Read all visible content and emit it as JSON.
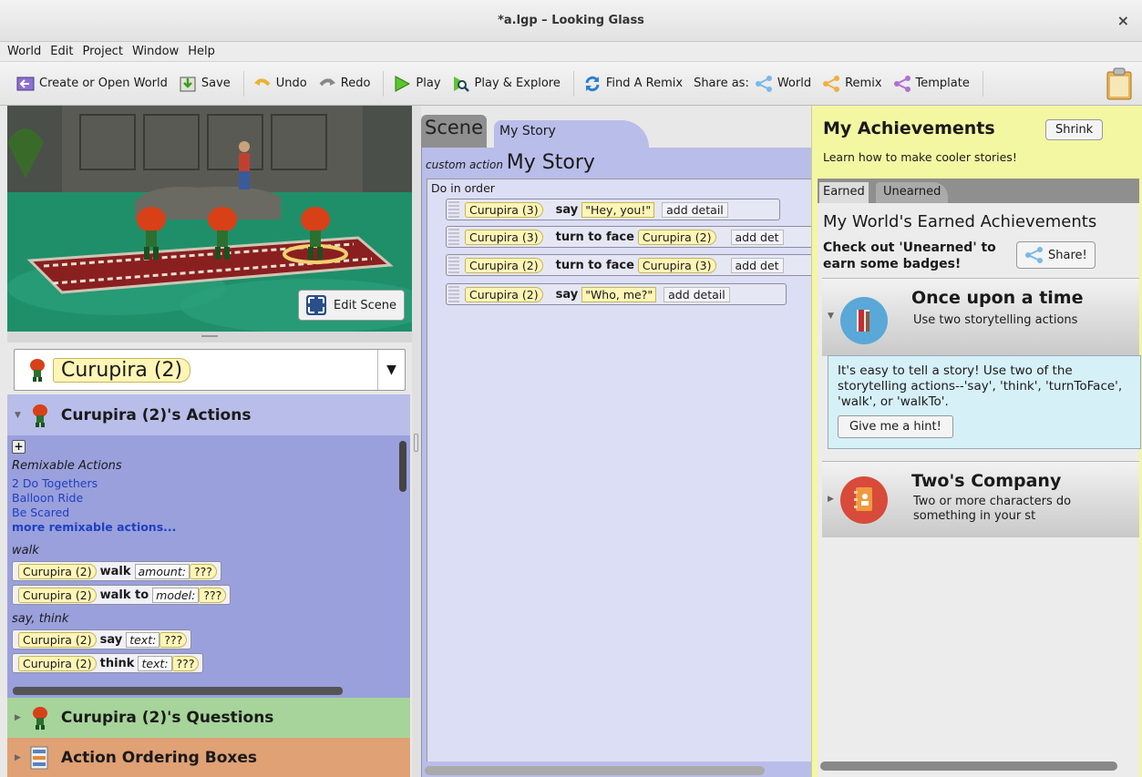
{
  "window": {
    "title": "*a.lgp – Looking Glass",
    "close": "×"
  },
  "menu": [
    "World",
    "Edit",
    "Project",
    "Window",
    "Help"
  ],
  "toolbar": {
    "create": "Create or Open World",
    "save": "Save",
    "undo": "Undo",
    "redo": "Redo",
    "play": "Play",
    "explore": "Play & Explore",
    "remix": "Find A Remix",
    "share_as": "Share as:",
    "share_world": "World",
    "share_remix": "Remix",
    "share_template": "Template"
  },
  "scene": {
    "edit_scene": "Edit Scene"
  },
  "selector": {
    "selected": "Curupira (2)"
  },
  "actions": {
    "header": "Curupira (2)'s Actions",
    "plus": "+",
    "remix_title": "Remixable Actions",
    "remix_items": [
      "2 Do Togethers",
      "Balloon Ride",
      "Be Scared"
    ],
    "more": "more remixable actions...",
    "walk_section": "walk",
    "walk": {
      "subject": "Curupira (2)",
      "verb": "walk",
      "param": "amount:",
      "val": "???"
    },
    "walkto": {
      "subject": "Curupira (2)",
      "verb": "walk to",
      "param": "model:",
      "val": "???"
    },
    "say_section": "say, think",
    "say": {
      "subject": "Curupira (2)",
      "verb": "say",
      "param": "text:",
      "val": "???"
    },
    "think": {
      "subject": "Curupira (2)",
      "verb": "think",
      "param": "text:",
      "val": "???"
    }
  },
  "questions": {
    "header": "Curupira (2)'s Questions"
  },
  "ordering": {
    "header": "Action Ordering Boxes"
  },
  "editor": {
    "tab_scene": "Scene",
    "tab_story": "My Story",
    "custom_action": "custom action",
    "story_name": "My Story",
    "do_in_order": "Do in order",
    "stmts": [
      {
        "subject": "Curupira (3)",
        "verb": "say",
        "arg": "\"Hey, you!\"",
        "detail": "add detail"
      },
      {
        "subject": "Curupira (3)",
        "verb": "turn to face",
        "arg": "Curupira (2)",
        "detail": "add det"
      },
      {
        "subject": "Curupira (2)",
        "verb": "turn to face",
        "arg": "Curupira (3)",
        "detail": "add det"
      },
      {
        "subject": "Curupira (2)",
        "verb": "say",
        "arg": "\"Who, me?\"",
        "detail": "add detail"
      }
    ]
  },
  "achievements": {
    "title": "My Achievements",
    "shrink": "Shrink",
    "learn": "Learn how to make cooler stories!",
    "tab_earned": "Earned",
    "tab_unearned": "Unearned",
    "heading": "My World's Earned Achievements",
    "sub1": "Check out 'Unearned' to",
    "sub2": "earn some badges!",
    "share": "Share!",
    "card1": {
      "title": "Once upon a time",
      "desc": "Use two storytelling actions"
    },
    "expanded": {
      "text": "It's easy to tell a story! Use two of the storytelling actions--'say', 'think', 'turnToFace', 'walk', or 'walkTo'.",
      "hint": "Give me a hint!"
    },
    "card2": {
      "title": "Two's Company",
      "desc": "Two or more characters do something in your st"
    }
  }
}
